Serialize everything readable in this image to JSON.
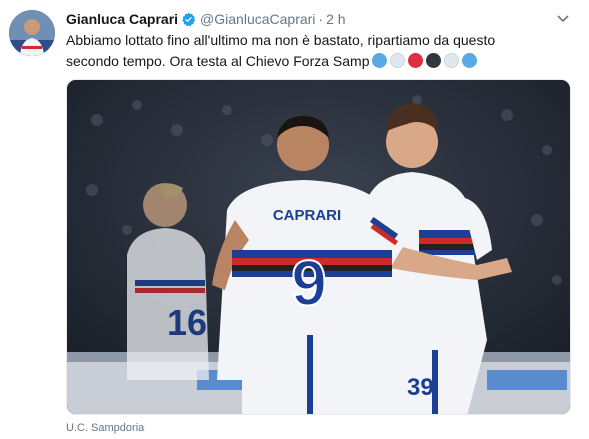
{
  "tweet": {
    "author_name": "Gianluca Caprari",
    "author_handle": "@GianlucaCaprari",
    "separator": "·",
    "timestamp": "2 h",
    "text_line1": "Abbiamo lottato fino all'ultimo ma non è bastato, ripartiamo da questo",
    "text_line2": "secondo tempo. Ora testa al Chievo Forza Samp",
    "emoji_hearts": [
      "#5aa9e6",
      "#e1e8ed",
      "#dd2e44",
      "#31373d",
      "#e1e8ed",
      "#5aa9e6"
    ],
    "photo_caption": "U.C. Sampdoria"
  },
  "photo": {
    "jersey_name": "CAPRARI",
    "jersey_number": "9",
    "left_player_number": "16",
    "right_player_number": "39"
  },
  "icons": {
    "verified": "verified-badge-icon",
    "more": "chevron-down-icon"
  },
  "colors": {
    "verified_blue": "#1da1f2",
    "secondary_text": "#657786",
    "sampdoria_blue": "#1b3f94",
    "sampdoria_red": "#cf2a2a"
  }
}
